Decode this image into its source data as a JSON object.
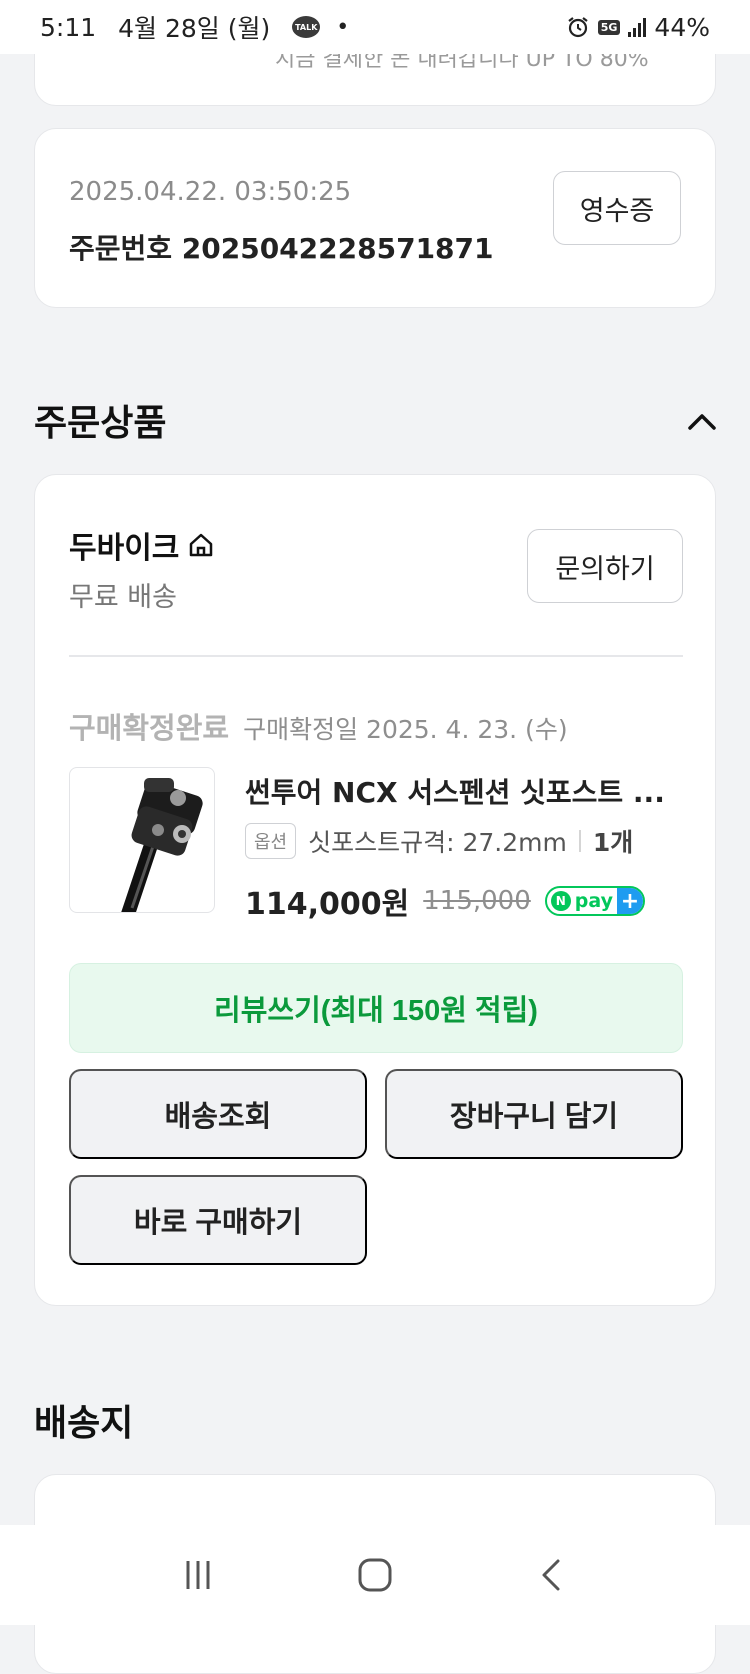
{
  "status_bar": {
    "time": "5:11",
    "date": "4월 28일 (월)",
    "talk_label": "TALK",
    "network": "5G",
    "battery": "44%"
  },
  "top_card": {
    "faded_text": "지금 결제한 돈 내려갑니다 UP TO 80%"
  },
  "order": {
    "datetime": "2025.04.22. 03:50:25",
    "order_number": "주문번호 2025042228571871",
    "receipt_button": "영수증"
  },
  "sections": {
    "ordered_items": "주문상품",
    "shipping_address": "배송지"
  },
  "seller": {
    "name": "두바이크",
    "shipping": "무료 배송",
    "inquiry_button": "문의하기"
  },
  "item": {
    "status": "구매확정완료",
    "confirm_date": "구매확정일 2025. 4. 23. (수)",
    "name": "썬투어 NCX 서스펜션 싯포스트 ...",
    "option_badge": "옵션",
    "option": "싯포스트규격: 27.2mm",
    "quantity": "1개",
    "price": "114,000원",
    "original_price": "115,000",
    "npay_label": "pay"
  },
  "actions": {
    "review": "리뷰쓰기(최대 150원 적립)",
    "track_delivery": "배송조회",
    "add_to_cart": "장바구니 담기",
    "buy_now": "바로 구매하기"
  }
}
